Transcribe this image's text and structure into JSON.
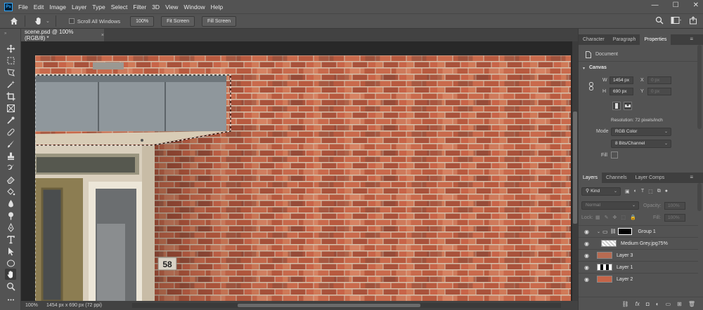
{
  "app": {
    "logo": "Ps"
  },
  "menu": [
    "File",
    "Edit",
    "Image",
    "Layer",
    "Type",
    "Select",
    "Filter",
    "3D",
    "View",
    "Window",
    "Help"
  ],
  "window_controls": {
    "minimize": "—",
    "maximize": "☐",
    "close": "✕"
  },
  "options_bar": {
    "scroll_all_label": "Scroll All Windows",
    "zoom_value": "100%",
    "fit_screen_label": "Fit Screen",
    "fill_screen_label": "Fill Screen"
  },
  "document_tab": {
    "title": "scene.psd @ 100% (RGB/8) *",
    "close": "×"
  },
  "canvas": {
    "house_number": "58"
  },
  "status": {
    "zoom": "100%",
    "dimensions": "1454 px x 690 px (72 ppi)",
    "arrow": ">"
  },
  "properties_panel": {
    "tabs": [
      "Character",
      "Paragraph",
      "Properties"
    ],
    "active_tab": "Properties",
    "doc_label": "Document",
    "section": "Canvas",
    "w_label": "W",
    "w_value": "1454 px",
    "h_label": "H",
    "h_value": "690 px",
    "x_label": "X",
    "x_value": "0 px",
    "y_label": "Y",
    "y_value": "0 px",
    "resolution": "Resolution: 72 pixels/inch",
    "mode_label": "Mode",
    "mode_value": "RGB Color",
    "depth_value": "8 Bits/Channel",
    "fill_label": "Fill"
  },
  "layers_panel": {
    "tabs": [
      "Layers",
      "Channels",
      "Layer Comps"
    ],
    "active_tab": "Layers",
    "filter_kind": "Kind",
    "blend_mode": "Normal",
    "opacity_label": "Opacity:",
    "opacity_value": "100%",
    "lock_label": "Lock:",
    "fill_label": "Fill:",
    "fill_value": "100%",
    "layers": [
      {
        "name": "Group 1"
      },
      {
        "name": "Medium Grey.jpg75%"
      },
      {
        "name": "Layer 3"
      },
      {
        "name": "Layer 1"
      },
      {
        "name": "Layer 2"
      }
    ]
  },
  "colors": {
    "brick": "#c8674a",
    "mortar": "#d8c4b0",
    "ui_bg": "#535353",
    "accent": "#31a8ff"
  }
}
